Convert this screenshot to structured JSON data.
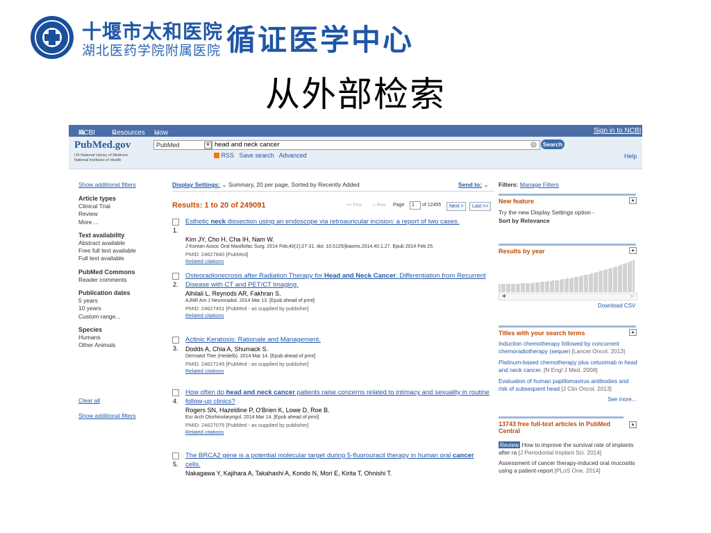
{
  "slide": {
    "hospital_name": "十堰市太和医院",
    "hospital_subname": "湖北医药学院附属医院",
    "center_title": "循证医学中心",
    "title": "从外部检索"
  },
  "ncbi_bar": {
    "logo": "NCBI",
    "resources": "Resources",
    "howto": "How To",
    "signin": "Sign in to NCBI"
  },
  "search": {
    "brand": "PubMed.gov",
    "brand_line1": "US National Library of Medicine",
    "brand_line2": "National Institutes of Health",
    "db": "PubMed",
    "query": "head and neck cancer",
    "search_button": "Search",
    "rss": "RSS",
    "save_search": "Save search",
    "advanced": "Advanced",
    "help": "Help"
  },
  "sidebar": {
    "show_filters_top": "Show additional filters",
    "groups": [
      {
        "heading": "Article types",
        "items": [
          "Clinical Trial",
          "Review",
          "More ..."
        ]
      },
      {
        "heading": "Text availability",
        "items": [
          "Abstract available",
          "Free full text available",
          "Full text available"
        ]
      },
      {
        "heading": "PubMed Commons",
        "items": [
          "Reader comments"
        ]
      },
      {
        "heading": "Publication dates",
        "items": [
          "5 years",
          "10 years",
          "Custom range..."
        ]
      },
      {
        "heading": "Species",
        "items": [
          "Humans",
          "Other Animals"
        ]
      }
    ],
    "clear_all": "Clear all",
    "show_filters_bottom": "Show additional filters"
  },
  "display": {
    "settings_label": "Display Settings:",
    "settings_value": "Summary, 20 per page, Sorted by Recently Added",
    "send_to": "Send to:"
  },
  "results": {
    "summary": "Results: 1 to 20 of 249091",
    "first": "<< First",
    "prev": "< Prev",
    "page_label": "Page",
    "page": "1",
    "of_pages": "of 12455",
    "next": "Next >",
    "last": "Last >>",
    "items": [
      {
        "num": "1.",
        "title_segments": [
          {
            "t": "Esthetic ",
            "b": false
          },
          {
            "t": "neck",
            "b": true
          },
          {
            "t": " dissection using an endoscope via retroauricular incision: a report of two cases.",
            "b": false
          }
        ],
        "authors": "Kim JY, Cho H, Cha IH, Nam W.",
        "cite": "J Korean Assoc Oral Maxillofac Surg. 2014 Feb;40(1):27-31. doi: 10.5125/jkaoms.2014.40.1.27. Epub 2014 Feb 25.",
        "pmid": "PMID: 24627840 [PubMed]",
        "related": "Related citations"
      },
      {
        "num": "2.",
        "title_segments": [
          {
            "t": "Osteoradionecrosis after Radiation Therapy for ",
            "b": false
          },
          {
            "t": "Head and Neck Cancer",
            "b": true
          },
          {
            "t": ": Differentiation from Recurrent Disease with CT and PET/CT Imaging.",
            "b": false
          }
        ],
        "authors": "Alhilali L, Reynods AR, Fakhran S.",
        "cite": "AJNR Am J Neuroradiol. 2014 Mar 13. [Epub ahead of print]",
        "pmid": "PMID: 24627451 [PubMed - as supplied by publisher]",
        "related": "Related citations"
      },
      {
        "num": "3.",
        "title_segments": [
          {
            "t": "Actinic Keratosis: Rationale and Management.",
            "b": false
          }
        ],
        "authors": "Dodds A, Chia A, Shumack S.",
        "cite": "Dermatol Ther (Heidelb). 2014 Mar 14. [Epub ahead of print]",
        "pmid": "PMID: 24627245 [PubMed - as supplied by publisher]",
        "related": "Related citations"
      },
      {
        "num": "4.",
        "title_segments": [
          {
            "t": "How often do ",
            "b": false
          },
          {
            "t": "head and neck cancer",
            "b": true
          },
          {
            "t": " patients raise concerns related to intimacy and sexuality in routine follow-up clinics?",
            "b": false
          }
        ],
        "authors": "Rogers SN, Hazeldine P, O'Brien K, Lowe D, Roe B.",
        "cite": "Eur Arch Otorhinolaryngol. 2014 Mar 14. [Epub ahead of print]",
        "pmid": "PMID: 24627075 [PubMed - as supplied by publisher]",
        "related": "Related citations"
      },
      {
        "num": "5.",
        "title_segments": [
          {
            "t": "The BRCA2 gene is a potential molecular target during 5-fluorouracil therapy in human oral ",
            "b": false
          },
          {
            "t": "cancer",
            "b": true
          },
          {
            "t": " cells.",
            "b": false
          }
        ],
        "authors": "Nakagawa Y, Kajihara A, Takahashi A, Kondo N, Mori E, Kirita T, Ohnishi T."
      }
    ]
  },
  "right": {
    "filters_label": "Filters:",
    "manage_filters": "Manage Filters",
    "new_feature_title": "New feature",
    "new_feature_text": "Try the new Display Settings option -",
    "new_feature_bold": "Sort by Relevance",
    "results_by_year": "Results by year",
    "download_csv": "Download CSV",
    "titles_heading": "Titles with your search terms",
    "titles": [
      {
        "text": "Induction chemotherapy followed by concurrent chemoradiotherapy (sequen",
        "source": "[Lancet Oncol. 2013]"
      },
      {
        "text": "Platinum-based chemotherapy plus cetuximab in head and neck cancer.",
        "source": "[N Engl J Med. 2008]"
      },
      {
        "text": "Evaluation of human papillomavirus antibodies and risk of subsequent head",
        "source": "[J Clin Oncol. 2013]"
      }
    ],
    "see_more": "See more...",
    "pmc_heading": "13743 free full-text articles in PubMed Central",
    "pmc_items": [
      {
        "badge": "Review",
        "text": "How to improve the survival rate of implants after ra",
        "source": "[J Periodontal Implant Sci. 2014]"
      },
      {
        "text": "Assessment of cancer therapy-induced oral mucositis using a patient-report",
        "source": "[PLoS One. 2014]"
      }
    ]
  }
}
